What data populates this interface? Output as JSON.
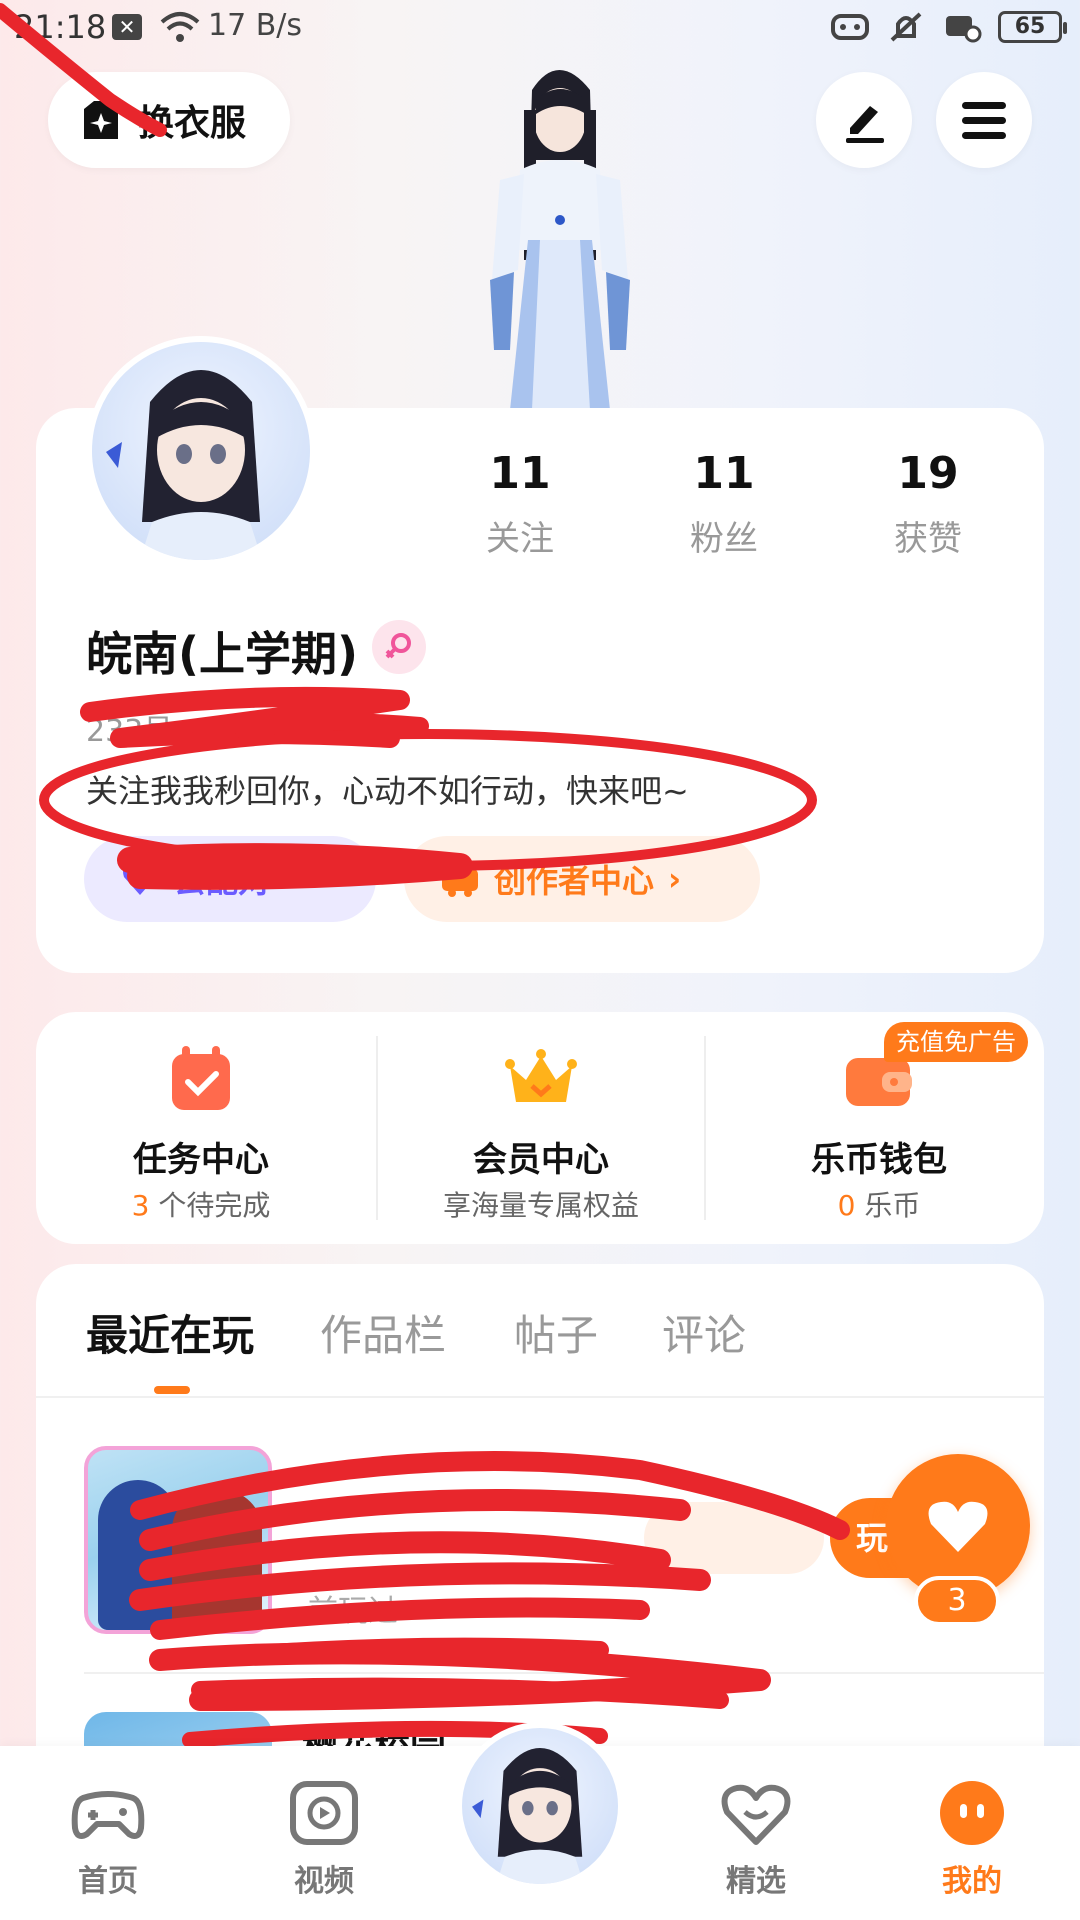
{
  "status_bar": {
    "time": "21:18",
    "network_speed": "17 B/s",
    "battery": "65"
  },
  "header": {
    "wardrobe_label": "换衣服",
    "edit_icon": "pen-icon",
    "menu_icon": "menu-icon"
  },
  "profile": {
    "stats": [
      {
        "value": "11",
        "label": "关注"
      },
      {
        "value": "11",
        "label": "粉丝"
      },
      {
        "value": "19",
        "label": "获赞"
      }
    ],
    "username": "皖南(上学期)",
    "uid_label": "233号:",
    "bio": "关注我我秒回你，心动不如行动，快来吧~",
    "match_button": "去配对",
    "creator_button": "创作者中心"
  },
  "services": [
    {
      "title": "任务中心",
      "count": "3",
      "sub": " 个待完成",
      "icon": "calendar-check-icon"
    },
    {
      "title": "会员中心",
      "count": "",
      "sub": "享海量专属权益",
      "icon": "crown-icon"
    },
    {
      "title": "乐币钱包",
      "count": "0",
      "sub": " 乐币",
      "icon": "wallet-icon",
      "tag": "充值免广告"
    }
  ],
  "tabs": [
    "最近在玩",
    "作品栏",
    "帖子",
    "评论"
  ],
  "active_tab": "最近在玩",
  "recent_games": [
    {
      "subtitle": "前玩过",
      "tag": "",
      "play_label": "玩"
    },
    {
      "title": "樱花校园"
    }
  ],
  "like_fab": {
    "count": "3"
  },
  "bottom_nav": [
    {
      "label": "首页",
      "icon": "gamepad-icon"
    },
    {
      "label": "视频",
      "icon": "video-icon"
    },
    {
      "label": "",
      "icon": "avatar"
    },
    {
      "label": "精选",
      "icon": "heart-chat-icon"
    },
    {
      "label": "我的",
      "icon": "profile-face-icon"
    }
  ],
  "colors": {
    "accent": "#ff7a1a",
    "scribble": "#e8262c",
    "match": "#6b5cff"
  }
}
